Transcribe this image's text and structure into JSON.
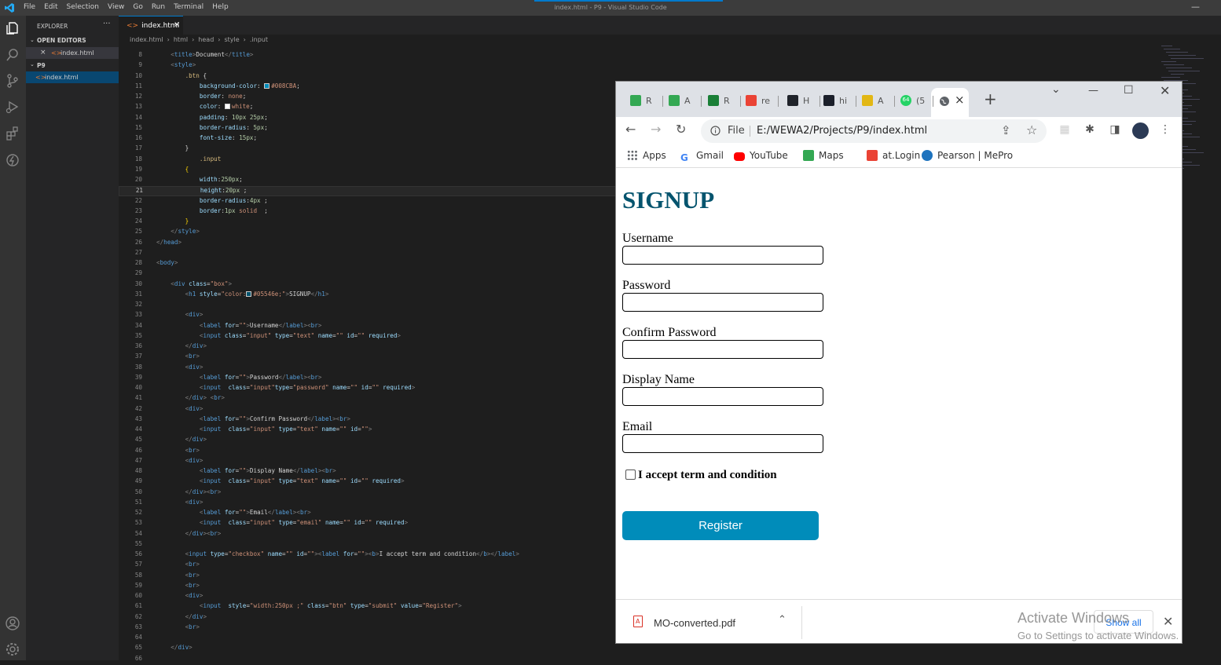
{
  "vscode": {
    "window_title": "index.html - P9 - Visual Studio Code",
    "menu": [
      "File",
      "Edit",
      "Selection",
      "View",
      "Go",
      "Run",
      "Terminal",
      "Help"
    ],
    "explorer": {
      "header": "EXPLORER",
      "open_editors": "OPEN EDITORS",
      "open_file": "index.html",
      "folder": "P9",
      "folder_file": "index.html"
    },
    "tab": "index.html",
    "breadcrumb": [
      "index.html",
      "html",
      "head",
      "style",
      ".input"
    ],
    "current_line": 21,
    "code": [
      {
        "n": 8,
        "html": "<span class='x'>    </span><span class='p'>&lt;</span><span class='t'>title</span><span class='p'>&gt;</span><span class='x'>Document</span><span class='p'>&lt;/</span><span class='t'>title</span><span class='p'>&gt;</span>"
      },
      {
        "n": 9,
        "html": "<span class='x'>    </span><span class='p'>&lt;</span><span class='t'>style</span><span class='p'>&gt;</span>"
      },
      {
        "n": 10,
        "html": "<span class='x'>        </span><span class='sel'>.btn</span><span class='x'> {</span>"
      },
      {
        "n": 11,
        "html": "<span class='x'>            </span><span class='a'>background-color</span><span class='x'>: </span><span class='sw' style='background:#008CBA'></span><span class='s'>#008CBA</span><span class='x'>;</span>"
      },
      {
        "n": 12,
        "html": "<span class='x'>            </span><span class='a'>border</span><span class='x'>: </span><span class='s'>none</span><span class='x'>;</span>"
      },
      {
        "n": 13,
        "html": "<span class='x'>            </span><span class='a'>color</span><span class='x'>: </span><span class='sw' style='background:#fff'></span><span class='s'>white</span><span class='x'>;</span>"
      },
      {
        "n": 14,
        "html": "<span class='x'>            </span><span class='a'>padding</span><span class='x'>: </span><span class='num'>10px 25px</span><span class='x'>;</span>"
      },
      {
        "n": 15,
        "html": "<span class='x'>            </span><span class='a'>border-radius</span><span class='x'>: </span><span class='num'>5px</span><span class='x'>;</span>"
      },
      {
        "n": 16,
        "html": "<span class='x'>            </span><span class='a'>font-size</span><span class='x'>: </span><span class='num'>15px</span><span class='x'>;</span>"
      },
      {
        "n": 17,
        "html": "<span class='x'>        }</span>"
      },
      {
        "n": 18,
        "html": "<span class='x'>            </span><span class='sel'>.input</span>"
      },
      {
        "n": 19,
        "html": "<span class='x'>        </span><span style='color:#ffd700'>{</span>"
      },
      {
        "n": 20,
        "html": "<span class='x'>            </span><span class='a'>width</span><span class='x'>:</span><span class='num'>250px</span><span class='x'>;</span>"
      },
      {
        "n": 21,
        "html": "<span class='x'>            </span><span class='a'>height</span><span class='x'>:</span><span class='num'>20px</span><span class='x'> ;</span>"
      },
      {
        "n": 22,
        "html": "<span class='x'>            </span><span class='a'>border-radius</span><span class='x'>:</span><span class='num'>4px</span><span class='x'> ;</span>"
      },
      {
        "n": 23,
        "html": "<span class='x'>            </span><span class='a'>border</span><span class='x'>:</span><span class='num'>1px</span><span class='s'> solid</span><span class='x'>  ;</span>"
      },
      {
        "n": 24,
        "html": "<span class='x'>        </span><span style='color:#ffd700'>}</span>"
      },
      {
        "n": 25,
        "html": "<span class='x'>    </span><span class='p'>&lt;/</span><span class='t'>style</span><span class='p'>&gt;</span>"
      },
      {
        "n": 26,
        "html": "<span class='p'>&lt;/</span><span class='t'>head</span><span class='p'>&gt;</span>"
      },
      {
        "n": 27,
        "html": ""
      },
      {
        "n": 28,
        "html": "<span class='p'>&lt;</span><span class='t'>body</span><span class='p'>&gt;</span>"
      },
      {
        "n": 29,
        "html": ""
      },
      {
        "n": 30,
        "html": "<span class='x'>    </span><span class='p'>&lt;</span><span class='t'>div</span><span class='a'> class</span><span class='x'>=</span><span class='s'>\"box\"</span><span class='p'>&gt;</span>"
      },
      {
        "n": 31,
        "html": "<span class='x'>        </span><span class='p'>&lt;</span><span class='t'>h1</span><span class='a'> style</span><span class='x'>=</span><span class='s'>\"color:</span><span class='sw' style='background:#05546e'></span><span class='s'>#05546e;\"</span><span class='p'>&gt;</span><span class='x'>SIGNUP</span><span class='p'>&lt;/</span><span class='t'>h1</span><span class='p'>&gt;</span>"
      },
      {
        "n": 32,
        "html": ""
      },
      {
        "n": 33,
        "html": "<span class='x'>        </span><span class='p'>&lt;</span><span class='t'>div</span><span class='p'>&gt;</span>"
      },
      {
        "n": 34,
        "html": "<span class='x'>            </span><span class='p'>&lt;</span><span class='t'>label</span><span class='a'> for</span><span class='x'>=</span><span class='s'>\"\"</span><span class='p'>&gt;</span><span class='x'>Username</span><span class='p'>&lt;/</span><span class='t'>label</span><span class='p'>&gt;&lt;</span><span class='t'>br</span><span class='p'>&gt;</span>"
      },
      {
        "n": 35,
        "html": "<span class='x'>            </span><span class='p'>&lt;</span><span class='t'>input</span><span class='a'> class</span><span class='x'>=</span><span class='s'>\"input\"</span><span class='a'> type</span><span class='x'>=</span><span class='s'>\"text\"</span><span class='a'> name</span><span class='x'>=</span><span class='s'>\"\"</span><span class='a'> id</span><span class='x'>=</span><span class='s'>\"\"</span><span class='a'> required</span><span class='p'>&gt;</span>"
      },
      {
        "n": 36,
        "html": "<span class='x'>        </span><span class='p'>&lt;/</span><span class='t'>div</span><span class='p'>&gt;</span>"
      },
      {
        "n": 37,
        "html": "<span class='x'>        </span><span class='p'>&lt;</span><span class='t'>br</span><span class='p'>&gt;</span>"
      },
      {
        "n": 38,
        "html": "<span class='x'>        </span><span class='p'>&lt;</span><span class='t'>div</span><span class='p'>&gt;</span>"
      },
      {
        "n": 39,
        "html": "<span class='x'>            </span><span class='p'>&lt;</span><span class='t'>label</span><span class='a'> for</span><span class='x'>=</span><span class='s'>\"\"</span><span class='p'>&gt;</span><span class='x'>Password</span><span class='p'>&lt;/</span><span class='t'>label</span><span class='p'>&gt;&lt;</span><span class='t'>br</span><span class='p'>&gt;</span>"
      },
      {
        "n": 40,
        "html": "<span class='x'>            </span><span class='p'>&lt;</span><span class='t'>input</span><span class='a'>  class</span><span class='x'>=</span><span class='s'>\"input\"</span><span class='a'>type</span><span class='x'>=</span><span class='s'>\"password\"</span><span class='a'> name</span><span class='x'>=</span><span class='s'>\"\"</span><span class='a'> id</span><span class='x'>=</span><span class='s'>\"\"</span><span class='a'> required</span><span class='p'>&gt;</span>"
      },
      {
        "n": 41,
        "html": "<span class='x'>        </span><span class='p'>&lt;/</span><span class='t'>div</span><span class='p'>&gt;</span><span class='x'> </span><span class='p'>&lt;</span><span class='t'>br</span><span class='p'>&gt;</span>"
      },
      {
        "n": 42,
        "html": "<span class='x'>        </span><span class='p'>&lt;</span><span class='t'>div</span><span class='p'>&gt;</span>"
      },
      {
        "n": 43,
        "html": "<span class='x'>            </span><span class='p'>&lt;</span><span class='t'>label</span><span class='a'> for</span><span class='x'>=</span><span class='s'>\"\"</span><span class='p'>&gt;</span><span class='x'>Confirm Password</span><span class='p'>&lt;/</span><span class='t'>label</span><span class='p'>&gt;&lt;</span><span class='t'>br</span><span class='p'>&gt;</span>"
      },
      {
        "n": 44,
        "html": "<span class='x'>            </span><span class='p'>&lt;</span><span class='t'>input</span><span class='a'>  class</span><span class='x'>=</span><span class='s'>\"input\"</span><span class='a'> type</span><span class='x'>=</span><span class='s'>\"text\"</span><span class='a'> name</span><span class='x'>=</span><span class='s'>\"\"</span><span class='a'> id</span><span class='x'>=</span><span class='s'>\"\"</span><span class='p'>&gt;</span>"
      },
      {
        "n": 45,
        "html": "<span class='x'>        </span><span class='p'>&lt;/</span><span class='t'>div</span><span class='p'>&gt;</span>"
      },
      {
        "n": 46,
        "html": "<span class='x'>        </span><span class='p'>&lt;</span><span class='t'>br</span><span class='p'>&gt;</span>"
      },
      {
        "n": 47,
        "html": "<span class='x'>        </span><span class='p'>&lt;</span><span class='t'>div</span><span class='p'>&gt;</span>"
      },
      {
        "n": 48,
        "html": "<span class='x'>            </span><span class='p'>&lt;</span><span class='t'>label</span><span class='a'> for</span><span class='x'>=</span><span class='s'>\"\"</span><span class='p'>&gt;</span><span class='x'>Display Name</span><span class='p'>&lt;/</span><span class='t'>label</span><span class='p'>&gt;&lt;</span><span class='t'>br</span><span class='p'>&gt;</span>"
      },
      {
        "n": 49,
        "html": "<span class='x'>            </span><span class='p'>&lt;</span><span class='t'>input</span><span class='a'>  class</span><span class='x'>=</span><span class='s'>\"input\"</span><span class='a'> type</span><span class='x'>=</span><span class='s'>\"text\"</span><span class='a'> name</span><span class='x'>=</span><span class='s'>\"\"</span><span class='a'> id</span><span class='x'>=</span><span class='s'>\"\"</span><span class='a'> required</span><span class='p'>&gt;</span>"
      },
      {
        "n": 50,
        "html": "<span class='x'>        </span><span class='p'>&lt;/</span><span class='t'>div</span><span class='p'>&gt;&lt;</span><span class='t'>br</span><span class='p'>&gt;</span>"
      },
      {
        "n": 51,
        "html": "<span class='x'>        </span><span class='p'>&lt;</span><span class='t'>div</span><span class='p'>&gt;</span>"
      },
      {
        "n": 52,
        "html": "<span class='x'>            </span><span class='p'>&lt;</span><span class='t'>label</span><span class='a'> for</span><span class='x'>=</span><span class='s'>\"\"</span><span class='p'>&gt;</span><span class='x'>Email</span><span class='p'>&lt;/</span><span class='t'>label</span><span class='p'>&gt;&lt;</span><span class='t'>br</span><span class='p'>&gt;</span>"
      },
      {
        "n": 53,
        "html": "<span class='x'>            </span><span class='p'>&lt;</span><span class='t'>input</span><span class='a'>  class</span><span class='x'>=</span><span class='s'>\"input\"</span><span class='a'> type</span><span class='x'>=</span><span class='s'>\"email\"</span><span class='a'> name</span><span class='x'>=</span><span class='s'>\"\"</span><span class='a'> id</span><span class='x'>=</span><span class='s'>\"\"</span><span class='a'> required</span><span class='p'>&gt;</span>"
      },
      {
        "n": 54,
        "html": "<span class='x'>        </span><span class='p'>&lt;/</span><span class='t'>div</span><span class='p'>&gt;&lt;</span><span class='t'>br</span><span class='p'>&gt;</span>"
      },
      {
        "n": 55,
        "html": ""
      },
      {
        "n": 56,
        "html": "<span class='x'>        </span><span class='p'>&lt;</span><span class='t'>input</span><span class='a'> type</span><span class='x'>=</span><span class='s'>\"checkbox\"</span><span class='a'> name</span><span class='x'>=</span><span class='s'>\"\"</span><span class='a'> id</span><span class='x'>=</span><span class='s'>\"\"</span><span class='p'>&gt;&lt;</span><span class='t'>label</span><span class='a'> for</span><span class='x'>=</span><span class='s'>\"\"</span><span class='p'>&gt;&lt;</span><span class='t'>b</span><span class='p'>&gt;</span><span class='x'>I accept term and condition</span><span class='p'>&lt;/</span><span class='t'>b</span><span class='p'>&gt;&lt;/</span><span class='t'>label</span><span class='p'>&gt;</span>"
      },
      {
        "n": 57,
        "html": "<span class='x'>        </span><span class='p'>&lt;</span><span class='t'>br</span><span class='p'>&gt;</span>"
      },
      {
        "n": 58,
        "html": "<span class='x'>        </span><span class='p'>&lt;</span><span class='t'>br</span><span class='p'>&gt;</span>"
      },
      {
        "n": 59,
        "html": "<span class='x'>        </span><span class='p'>&lt;</span><span class='t'>br</span><span class='p'>&gt;</span>"
      },
      {
        "n": 60,
        "html": "<span class='x'>        </span><span class='p'>&lt;</span><span class='t'>div</span><span class='p'>&gt;</span>"
      },
      {
        "n": 61,
        "html": "<span class='x'>            </span><span class='p'>&lt;</span><span class='t'>input</span><span class='a'>  style</span><span class='x'>=</span><span class='s'>\"width:250px ;\"</span><span class='a'> class</span><span class='x'>=</span><span class='s'>\"btn\"</span><span class='a'> type</span><span class='x'>=</span><span class='s'>\"submit\"</span><span class='a'> value</span><span class='x'>=</span><span class='s'>\"Register\"</span><span class='p'>&gt;</span>"
      },
      {
        "n": 62,
        "html": "<span class='x'>        </span><span class='p'>&lt;/</span><span class='t'>div</span><span class='p'>&gt;</span>"
      },
      {
        "n": 63,
        "html": "<span class='x'>        </span><span class='p'>&lt;</span><span class='t'>br</span><span class='p'>&gt;</span>"
      },
      {
        "n": 64,
        "html": ""
      },
      {
        "n": 65,
        "html": "<span class='x'>    </span><span class='p'>&lt;/</span><span class='t'>div</span><span class='p'>&gt;</span>"
      },
      {
        "n": 66,
        "html": ""
      }
    ]
  },
  "browser": {
    "tabs": [
      {
        "label": "R",
        "fav_color": "#34a853",
        "icon": "drive-icon"
      },
      {
        "label": "A",
        "fav_color": "#34a853",
        "icon": "drive-icon"
      },
      {
        "label": "R",
        "fav_color": "#1a7f37",
        "icon": "w3-icon"
      },
      {
        "label": "re",
        "fav_color": "#ea4335",
        "icon": "gmail-icon"
      },
      {
        "label": "H",
        "fav_color": "#20232a",
        "icon": "react-icon"
      },
      {
        "label": "hi",
        "fav_color": "#1b1f2a",
        "icon": "app-icon"
      },
      {
        "label": "A",
        "fav_color": "#e2b714",
        "icon": "classroom-icon"
      },
      {
        "label": "(5",
        "fav_color": "#25d366",
        "icon": "whatsapp-icon"
      }
    ],
    "whatsapp_badge": "64",
    "omnibox": {
      "label": "File",
      "url": "E:/WEWA2/Projects/P9/index.html"
    },
    "bookmarks": [
      {
        "label": "Apps",
        "icon": "apps-grid-icon",
        "color": "#5f6368"
      },
      {
        "label": "Gmail",
        "icon": "google-icon",
        "color": "#4285f4"
      },
      {
        "label": "YouTube",
        "icon": "youtube-icon",
        "color": "#ff0000"
      },
      {
        "label": "Maps",
        "icon": "maps-icon",
        "color": "#34a853"
      },
      {
        "label": "at.Login",
        "icon": "gmail-icon",
        "color": "#ea4335"
      },
      {
        "label": "Pearson | MePro",
        "icon": "pearson-icon",
        "color": "#1e73be"
      }
    ]
  },
  "page": {
    "title": "SIGNUP",
    "title_color": "#05546e",
    "fields": [
      {
        "label": "Username",
        "value": ""
      },
      {
        "label": "Password",
        "value": ""
      },
      {
        "label": "Confirm Password",
        "value": ""
      },
      {
        "label": "Display Name",
        "value": ""
      },
      {
        "label": "Email",
        "value": ""
      }
    ],
    "checkbox_label": "I accept term and condition",
    "register_label": "Register",
    "button_color": "#008cba"
  },
  "download_bar": {
    "file": "MO-converted.pdf",
    "show_all": "Show all"
  },
  "watermark": {
    "line1": "Activate Windows",
    "line2": "Go to Settings to activate Windows."
  }
}
